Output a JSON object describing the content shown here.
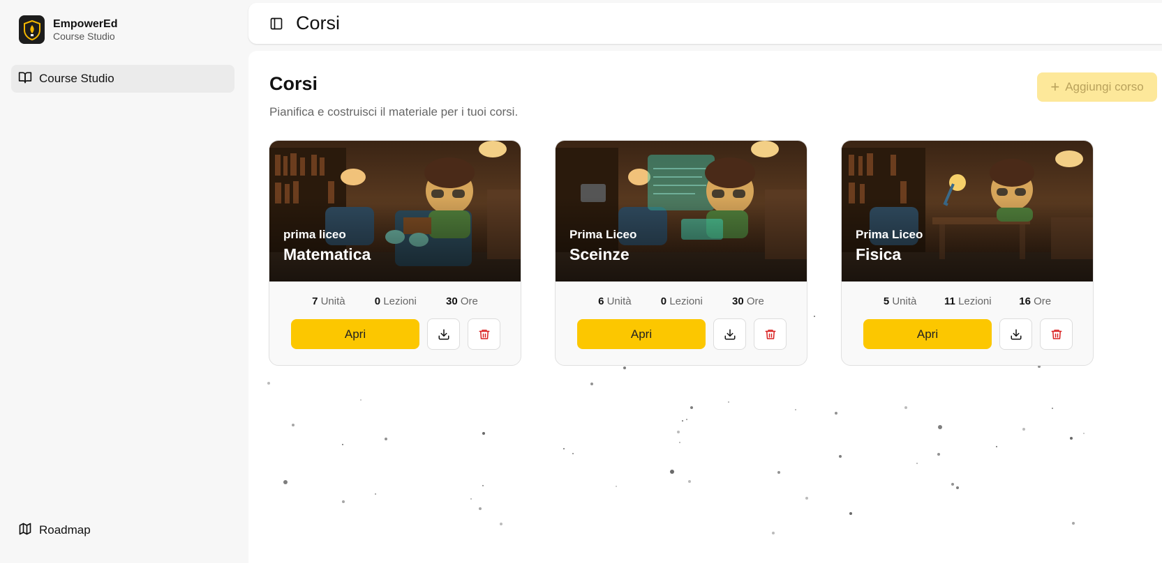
{
  "brand": {
    "name": "EmpowerEd",
    "subtitle": "Course Studio"
  },
  "sidebar": {
    "items": [
      {
        "label": "Course Studio",
        "icon": "book-open-icon"
      }
    ],
    "bottom": {
      "label": "Roadmap",
      "icon": "map-icon"
    }
  },
  "header": {
    "title": "Corsi"
  },
  "main": {
    "title": "Corsi",
    "subtitle": "Pianifica e costruisci il materiale per i tuoi corsi.",
    "add_button": "Aggiungi corso"
  },
  "courses": [
    {
      "subtitle": "prima liceo",
      "title": "Matematica",
      "units": "7",
      "units_label": "Unità",
      "lessons": "0",
      "lessons_label": "Lezioni",
      "hours": "30",
      "hours_label": "Ore",
      "open_label": "Apri"
    },
    {
      "subtitle": "Prima Liceo",
      "title": "Sceinze",
      "units": "6",
      "units_label": "Unità",
      "lessons": "0",
      "lessons_label": "Lezioni",
      "hours": "30",
      "hours_label": "Ore",
      "open_label": "Apri"
    },
    {
      "subtitle": "Prima Liceo",
      "title": "Fisica",
      "units": "5",
      "units_label": "Unità",
      "lessons": "11",
      "lessons_label": "Lezioni",
      "hours": "16",
      "hours_label": "Ore",
      "open_label": "Apri"
    }
  ],
  "colors": {
    "accent": "#fcc700",
    "delete": "#d92020"
  }
}
